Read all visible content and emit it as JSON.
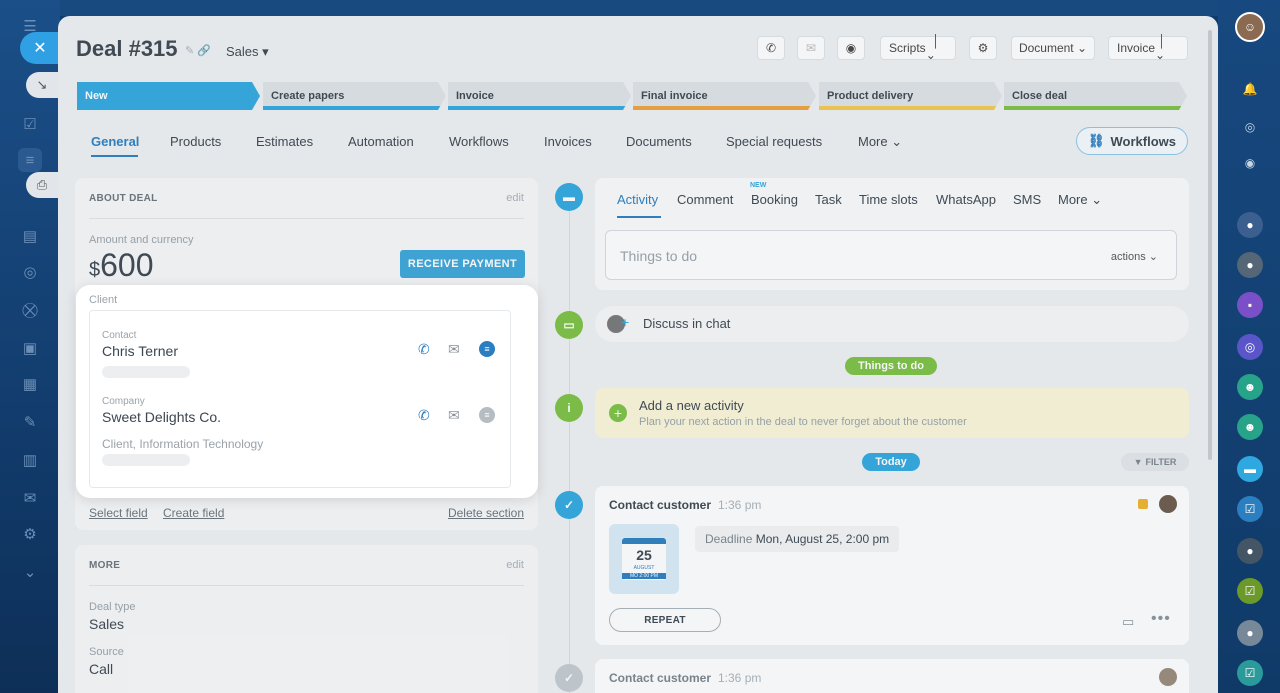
{
  "header": {
    "title": "Deal #315",
    "category": "Sales",
    "scripts_label": "Scripts",
    "document_label": "Document",
    "invoice_label": "Invoice"
  },
  "stages": [
    {
      "label": "New",
      "color": "#2fa8e0"
    },
    {
      "label": "Create papers",
      "color": "#2fa8e0"
    },
    {
      "label": "Invoice",
      "color": "#2fa8e0"
    },
    {
      "label": "Final invoice",
      "color": "#f0a23a"
    },
    {
      "label": "Product delivery",
      "color": "#f2c94c"
    },
    {
      "label": "Close deal",
      "color": "#7cc142"
    }
  ],
  "tabs": [
    "General",
    "Products",
    "Estimates",
    "Automation",
    "Workflows",
    "Invoices",
    "Documents",
    "Special requests",
    "More"
  ],
  "workflows_button": "Workflows",
  "about": {
    "heading": "ABOUT DEAL",
    "edit": "edit",
    "amount_label": "Amount and currency",
    "currency_symbol": "$",
    "amount": "600",
    "receive_payment": "RECEIVE PAYMENT",
    "client_label": "Client",
    "contact_label": "Contact",
    "contact_name": "Chris Terner",
    "company_label": "Company",
    "company_name": "Sweet Delights Co.",
    "company_info": "Client, Information Technology",
    "select_field": "Select field",
    "create_field": "Create field",
    "delete_section": "Delete section"
  },
  "more": {
    "heading": "MORE",
    "edit": "edit",
    "deal_type_label": "Deal type",
    "deal_type": "Sales",
    "source_label": "Source",
    "source": "Call"
  },
  "activity_tabs": {
    "new_badge": "NEW",
    "items": [
      "Activity",
      "Comment",
      "Booking",
      "Task",
      "Time slots",
      "WhatsApp",
      "SMS",
      "More"
    ]
  },
  "todo": {
    "placeholder": "Things to do",
    "actions": "actions"
  },
  "timeline": {
    "discuss_chat": "Discuss in chat",
    "things_to_do": "Things to do",
    "add_activity_title": "Add a new activity",
    "add_activity_desc": "Plan your next action in the deal to never forget about the customer",
    "today": "Today",
    "filter": "FILTER",
    "contact_customer_1": "Contact customer",
    "time_1": "1:36 pm",
    "calendar_day": "25",
    "calendar_month": "AUGUST",
    "calendar_time": "MO 2:00 PM",
    "deadline_label": "Deadline",
    "deadline_value": "Mon, August 25, 2:00 pm",
    "repeat": "REPEAT",
    "contact_customer_2": "Contact customer",
    "time_2": "1:36 pm"
  },
  "colors": {
    "accent": "#2b7ec0",
    "green": "#7cc142",
    "timeline_blue": "#2fa8e0"
  }
}
